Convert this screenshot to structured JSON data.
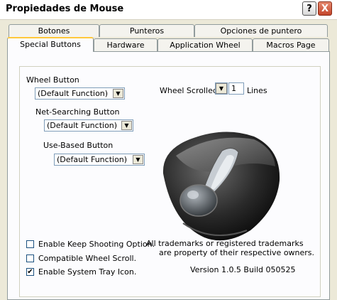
{
  "window": {
    "title": "Propiedades de Mouse",
    "help_btn": "?",
    "close_btn": "X"
  },
  "tabs_row1": [
    "Botones",
    "Punteros",
    "Opciones de puntero"
  ],
  "tabs_row2": [
    "Special Buttons",
    "Hardware",
    "Application Wheel",
    "Macros Page"
  ],
  "active_tab": "Special Buttons",
  "wheel_button": {
    "label": "Wheel Button",
    "value": "(Default Function)"
  },
  "net_search": {
    "label": "Net-Searching Button",
    "value": "(Default Function)"
  },
  "use_based": {
    "label": "Use-Based Button",
    "value": "(Default Function)"
  },
  "wheel_scrolled": {
    "label": "Wheel Scrolled",
    "value": "1",
    "unit": "Lines"
  },
  "checkboxes": [
    {
      "label": "Enable Keep Shooting Option.",
      "checked": false
    },
    {
      "label": "Compatible Wheel Scroll.",
      "checked": false
    },
    {
      "label": "Enable System Tray Icon.",
      "checked": true
    }
  ],
  "trademark_line1": "All trademarks or registered trademarks",
  "trademark_line2": "are property of their respective owners.",
  "version": "Version 1.0.5 Build 050525",
  "icons": {
    "dropdown": "chevron-down-icon",
    "check": "checkmark-icon"
  }
}
